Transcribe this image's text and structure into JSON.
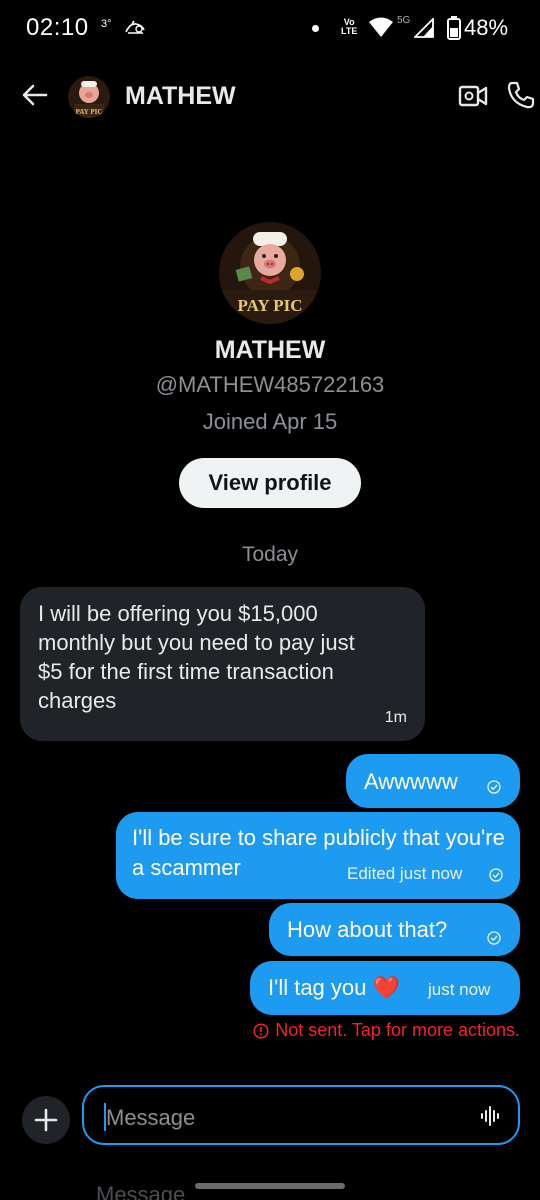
{
  "status_bar": {
    "time": "02:10",
    "temp": "3°",
    "network": "Vo\nLTE",
    "net_5g": "5G",
    "battery": "48%"
  },
  "header": {
    "name": "MATHEW",
    "avatar_text": "PAY PIC"
  },
  "profile": {
    "avatar_text": "PAY PIC",
    "name": "MATHEW",
    "handle": "@MATHEW485722163",
    "joined": "Joined Apr 15",
    "view_profile_label": "View profile"
  },
  "date_separator": "Today",
  "messages": {
    "incoming": {
      "text": "I will be offering you $15,000 monthly but you need to pay just $5 for the first time transaction charges",
      "time": "1m"
    },
    "out1": {
      "text": "Awwwww"
    },
    "out2": {
      "text": "I'll be sure to share publicly that you're a scammer",
      "meta": "Edited just now"
    },
    "out3": {
      "text": "How about that?"
    },
    "out4": {
      "text": "I'll tag you ❤️",
      "meta": "just now"
    },
    "error": "Not sent. Tap for more actions."
  },
  "composer": {
    "placeholder": "Message"
  },
  "ghost_text": "Message",
  "colors": {
    "accent": "#1d9bf0",
    "error": "#f4212e",
    "incoming_bubble": "#202327"
  }
}
